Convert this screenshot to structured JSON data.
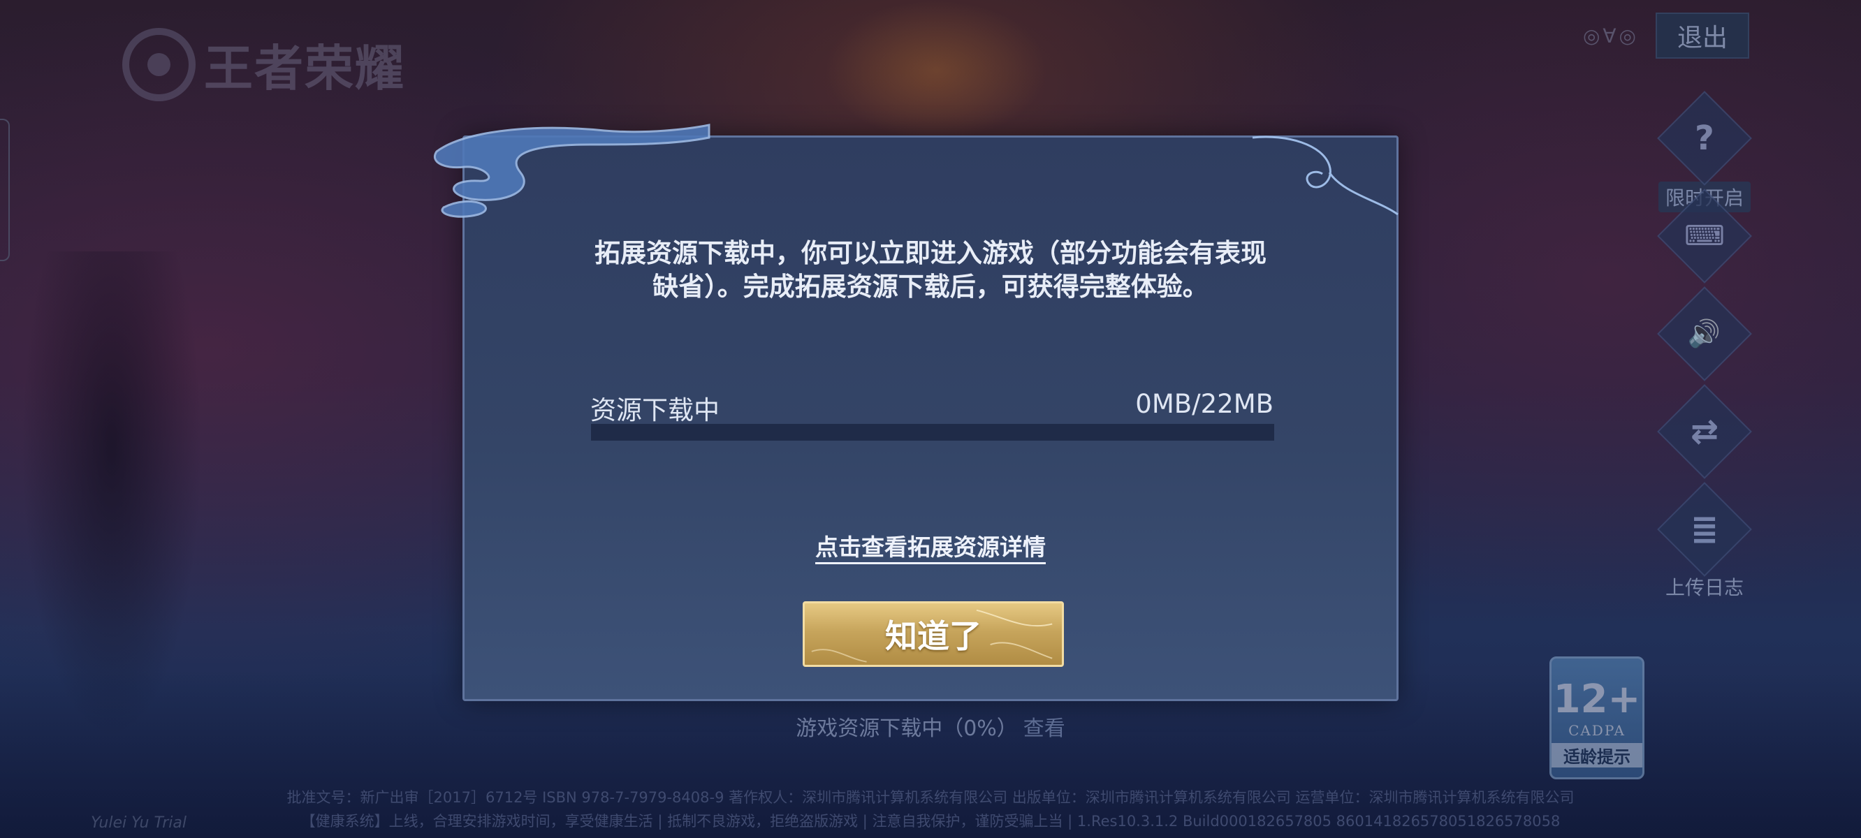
{
  "logo": {
    "text": "王者荣耀"
  },
  "top_right": {
    "icons_text": "◎∀◎",
    "exit_label": "退出"
  },
  "right_menu": [
    {
      "icon": "question-icon",
      "glyph": "?",
      "label": "限时开启"
    },
    {
      "icon": "gamepad-icon",
      "glyph": "⌨",
      "label": ""
    },
    {
      "icon": "speaker-icon",
      "glyph": "🔊",
      "label": ""
    },
    {
      "icon": "switch-account-icon",
      "glyph": "⇄",
      "label": ""
    },
    {
      "icon": "clipboard-icon",
      "glyph": "≣",
      "label": "上传日志"
    }
  ],
  "age_badge": {
    "age": "12+",
    "org": "CADPA",
    "tip": "适龄提示"
  },
  "dialog": {
    "message_line1": "拓展资源下载中，你可以立即进入游戏（部分功能会有表现",
    "message_line2": "缺省）。完成拓展资源下载后，可获得完整体验。",
    "progress_label": "资源下载中",
    "progress_size": "0MB/22MB",
    "progress_fraction": 0,
    "details_link": "点击查看拓展资源详情",
    "ok_button": "知道了"
  },
  "status": {
    "text": "游戏资源下载中（0%）",
    "view_link": "查看"
  },
  "legal": {
    "line1": "批准文号：新广出审［2017］6712号 ISBN 978-7-7979-8408-9 著作权人：深圳市腾讯计算机系统有限公司 出版单位：深圳市腾讯计算机系统有限公司 运营单位：深圳市腾讯计算机系统有限公司",
    "line2": "【健康系统】上线，合理安排游戏时间，享受健康生活 | 抵制不良游戏，拒绝盗版游戏 | 注意自我保护，谨防受骗上当 | 1.Res10.3.1.2 Build000182657805 860141826578051826578058"
  },
  "watermark": "Yulei Yu Trial"
}
